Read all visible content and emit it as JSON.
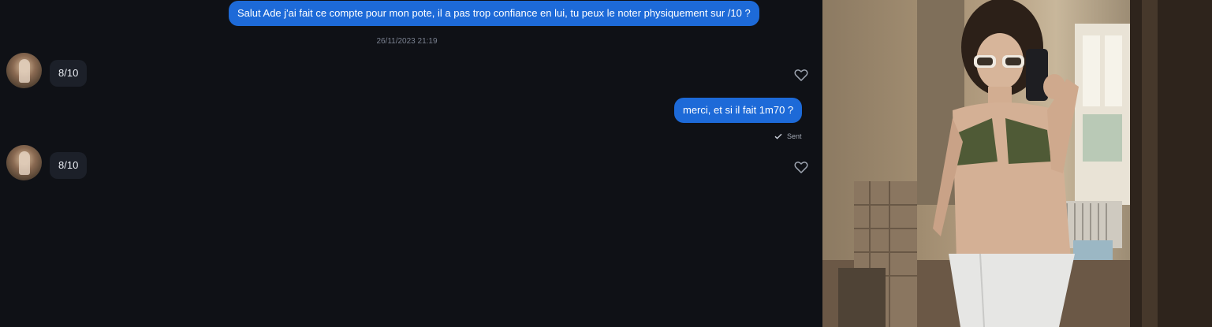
{
  "messages": [
    {
      "direction": "out",
      "text": "Salut Ade j'ai fait ce compte pour mon pote, il a pas trop confiance en lui, tu peux le noter physiquement sur /10 ?"
    },
    {
      "type": "timestamp",
      "text": "26/11/2023 21:19"
    },
    {
      "direction": "in",
      "text": "8/10"
    },
    {
      "direction": "out",
      "text": "merci, et si il fait 1m70 ?",
      "status": "Sent"
    },
    {
      "direction": "in",
      "text": "8/10"
    }
  ],
  "icons": {
    "like": "heart-outline-icon",
    "read_receipt": "check-mark-icon"
  },
  "colors": {
    "background": "#0f1116",
    "outgoing_bubble": "#1d6ad8",
    "incoming_bubble": "#1c2029"
  }
}
